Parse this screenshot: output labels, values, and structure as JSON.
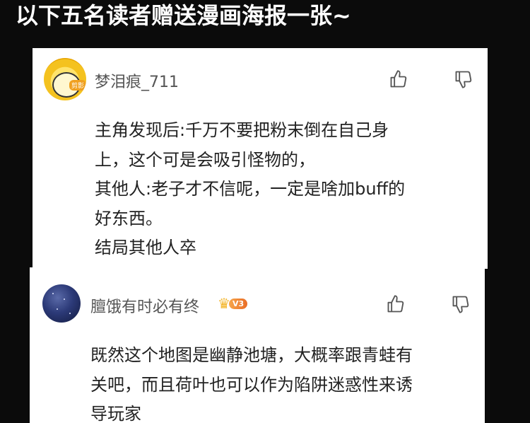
{
  "banner": {
    "title": "以下五名读者赠送漫画海报一张~"
  },
  "comments": [
    {
      "username": "梦泪痕_711",
      "avatar_badge": "剪影",
      "lines": [
        "主角发现后:千万不要把粉末倒在自己身",
        "上，这个可是会吸引怪物的，",
        "其他人:老子才不信呢，一定是啥加buff的",
        "好东西。",
        "结局其他人卒"
      ]
    },
    {
      "username": "膻饿有时必有终",
      "vip_level": "V3",
      "lines": [
        "既然这个地图是幽静池塘，大概率跟青蛙有",
        "关吧，而且荷叶也可以作为陷阱迷惑性来诱",
        "导玩家"
      ]
    }
  ],
  "icons": {
    "like": "thumbs-up-icon",
    "dislike": "thumbs-down-icon",
    "vip": "crown-icon"
  },
  "colors": {
    "background": "#0b0b0b",
    "card": "#ffffff",
    "vip_badge": "#ee8430"
  }
}
